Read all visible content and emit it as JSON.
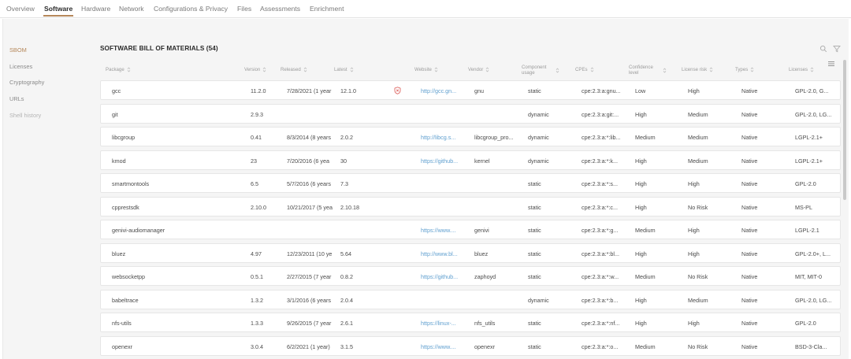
{
  "tabs": [
    {
      "label": "Overview",
      "active": false
    },
    {
      "label": "Software",
      "active": true
    },
    {
      "label": "Hardware",
      "active": false
    },
    {
      "label": "Network",
      "active": false
    },
    {
      "label": "Configurations & Privacy",
      "active": false
    },
    {
      "label": "Files",
      "active": false
    },
    {
      "label": "Assessments",
      "active": false
    },
    {
      "label": "Enrichment",
      "active": false
    }
  ],
  "sidebar": {
    "items": [
      {
        "label": "SBOM",
        "state": "active"
      },
      {
        "label": "Licenses",
        "state": "normal"
      },
      {
        "label": "Cryptography",
        "state": "normal"
      },
      {
        "label": "URLs",
        "state": "normal"
      },
      {
        "label": "Shell history",
        "state": "muted"
      }
    ]
  },
  "section": {
    "title": "SOFTWARE BILL OF MATERIALS (54)"
  },
  "toolbar": {
    "search_icon": "search-icon",
    "filter_icon": "filter-icon",
    "columns_icon": "columns-menu-icon"
  },
  "table": {
    "headers": [
      {
        "key": "package",
        "label": "Package"
      },
      {
        "key": "version",
        "label": "Version"
      },
      {
        "key": "released",
        "label": "Released"
      },
      {
        "key": "latest",
        "label": "Latest"
      },
      {
        "key": "website",
        "label": "Website"
      },
      {
        "key": "vendor",
        "label": "Vendor"
      },
      {
        "key": "component_usage",
        "label": "Component usage"
      },
      {
        "key": "cpes",
        "label": "CPEs"
      },
      {
        "key": "confidence",
        "label": "Confidence level"
      },
      {
        "key": "license_risk",
        "label": "License risk"
      },
      {
        "key": "types",
        "label": "Types"
      },
      {
        "key": "licenses",
        "label": "Licenses"
      }
    ],
    "rows": [
      {
        "package": "gcc",
        "version": "11.2.0",
        "released": "7/28/2021 (1 year",
        "latest": "12.1.0",
        "flag": true,
        "website": "http://gcc.gn...",
        "vendor": "gnu",
        "usage": "static",
        "cpes": "cpe:2.3:a:gnu...",
        "confidence": "Low",
        "license_risk": "High",
        "types": "Native",
        "licenses": "GPL-2.0, G..."
      },
      {
        "package": "git",
        "version": "2.9.3",
        "released": "",
        "latest": "",
        "flag": false,
        "website": "",
        "vendor": "",
        "usage": "dynamic",
        "cpes": "cpe:2.3:a:git:...",
        "confidence": "High",
        "license_risk": "Medium",
        "types": "Native",
        "licenses": "GPL-2.0, LG..."
      },
      {
        "package": "libcgroup",
        "version": "0.41",
        "released": "8/3/2014 (8 years",
        "latest": "2.0.2",
        "flag": false,
        "website": "http://libcg.s...",
        "vendor": "libcgroup_pro...",
        "usage": "dynamic",
        "cpes": "cpe:2.3:a:*:lib...",
        "confidence": "Medium",
        "license_risk": "Medium",
        "types": "Native",
        "licenses": "LGPL-2.1+"
      },
      {
        "package": "kmod",
        "version": "23",
        "released": "7/20/2016 (6 yea",
        "latest": "30",
        "flag": false,
        "website": "https://github...",
        "vendor": "kernel",
        "usage": "dynamic",
        "cpes": "cpe:2.3:a:*:k...",
        "confidence": "High",
        "license_risk": "Medium",
        "types": "Native",
        "licenses": "LGPL-2.1+"
      },
      {
        "package": "smartmontools",
        "version": "6.5",
        "released": "5/7/2016 (6 years",
        "latest": "7.3",
        "flag": false,
        "website": "",
        "vendor": "",
        "usage": "static",
        "cpes": "cpe:2.3:a:*:s...",
        "confidence": "High",
        "license_risk": "High",
        "types": "Native",
        "licenses": "GPL-2.0"
      },
      {
        "package": "cpprestsdk",
        "version": "2.10.0",
        "released": "10/21/2017 (5 yea",
        "latest": "2.10.18",
        "flag": false,
        "website": "",
        "vendor": "",
        "usage": "static",
        "cpes": "cpe:2.3:a:*:c...",
        "confidence": "High",
        "license_risk": "No Risk",
        "types": "Native",
        "licenses": "MS-PL"
      },
      {
        "package": "genivi-audiomanager",
        "version": "",
        "released": "",
        "latest": "",
        "flag": false,
        "website": "https://www....",
        "vendor": "genivi",
        "usage": "static",
        "cpes": "cpe:2.3:a:*:g...",
        "confidence": "Medium",
        "license_risk": "High",
        "types": "Native",
        "licenses": "LGPL-2.1"
      },
      {
        "package": "bluez",
        "version": "4.97",
        "released": "12/23/2011 (10 ye",
        "latest": "5.64",
        "flag": false,
        "website": "http://www.bl...",
        "vendor": "bluez",
        "usage": "static",
        "cpes": "cpe:2.3:a:*:bl...",
        "confidence": "High",
        "license_risk": "High",
        "types": "Native",
        "licenses": "GPL-2.0+, L..."
      },
      {
        "package": "websocketpp",
        "version": "0.5.1",
        "released": "2/27/2015 (7 year",
        "latest": "0.8.2",
        "flag": false,
        "website": "https://github...",
        "vendor": "zaphoyd",
        "usage": "static",
        "cpes": "cpe:2.3:a:*:w...",
        "confidence": "Medium",
        "license_risk": "No Risk",
        "types": "Native",
        "licenses": "MIT, MIT-0"
      },
      {
        "package": "babeltrace",
        "version": "1.3.2",
        "released": "3/1/2016 (6 years",
        "latest": "2.0.4",
        "flag": false,
        "website": "",
        "vendor": "",
        "usage": "dynamic",
        "cpes": "cpe:2.3:a:*:b...",
        "confidence": "High",
        "license_risk": "Medium",
        "types": "Native",
        "licenses": "GPL-2.0, LG..."
      },
      {
        "package": "nfs-utils",
        "version": "1.3.3",
        "released": "9/26/2015 (7 year",
        "latest": "2.6.1",
        "flag": false,
        "website": "https://linux-...",
        "vendor": "nfs_utils",
        "usage": "static",
        "cpes": "cpe:2.3:a:*:nf...",
        "confidence": "High",
        "license_risk": "High",
        "types": "Native",
        "licenses": "GPL-2.0"
      },
      {
        "package": "openexr",
        "version": "3.0.4",
        "released": "6/2/2021 (1 year)",
        "latest": "3.1.5",
        "flag": false,
        "website": "https://www....",
        "vendor": "openexr",
        "usage": "static",
        "cpes": "cpe:2.3:a:*:o...",
        "confidence": "Medium",
        "license_risk": "No Risk",
        "types": "Native",
        "licenses": "BSD-3-Cla..."
      }
    ]
  },
  "colors": {
    "accent": "#b5875a",
    "link": "#5f9fcf",
    "flag_icon": "#d9534f"
  }
}
